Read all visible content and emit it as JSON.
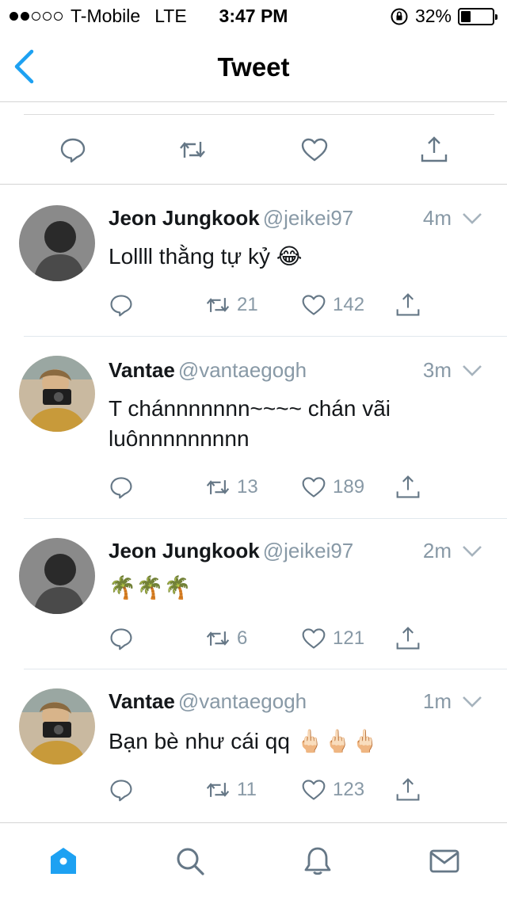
{
  "status_bar": {
    "carrier": "T-Mobile",
    "network": "LTE",
    "time": "3:47 PM",
    "battery_percent_label": "32%",
    "battery_level": 0.32,
    "signal_bars_filled": 2,
    "signal_bars_total": 5
  },
  "nav": {
    "title": "Tweet",
    "back_icon": "chevron-left-icon"
  },
  "top_actions": [
    "reply-icon",
    "retweet-icon",
    "heart-icon",
    "share-icon"
  ],
  "replies": [
    {
      "name": "Jeon Jungkook",
      "handle": "@jeikei97",
      "time": "4m",
      "text": "Lollll thằng tự kỷ 😂",
      "retweets": "21",
      "likes": "142",
      "avatar_style": "mono"
    },
    {
      "name": "Vantae",
      "handle": "@vantaegogh",
      "time": "3m",
      "text": "T chánnnnnnn~~~~ chán vãi luônnnnnnnnn",
      "retweets": "13",
      "likes": "189",
      "avatar_style": "color"
    },
    {
      "name": "Jeon Jungkook",
      "handle": "@jeikei97",
      "time": "2m",
      "text": "🌴🌴🌴",
      "retweets": "6",
      "likes": "121",
      "avatar_style": "mono"
    },
    {
      "name": "Vantae",
      "handle": "@vantaegogh",
      "time": "1m",
      "text": "Bạn bè như cái qq 🖕🏻🖕🏻🖕🏻",
      "retweets": "11",
      "likes": "123",
      "avatar_style": "color"
    }
  ],
  "tab_bar": [
    "home-icon",
    "search-icon",
    "notifications-icon",
    "messages-icon"
  ],
  "colors": {
    "accent": "#1da1f2",
    "icon_gray": "#657786",
    "secondary_text": "#8899a6",
    "primary_text": "#14171a"
  }
}
